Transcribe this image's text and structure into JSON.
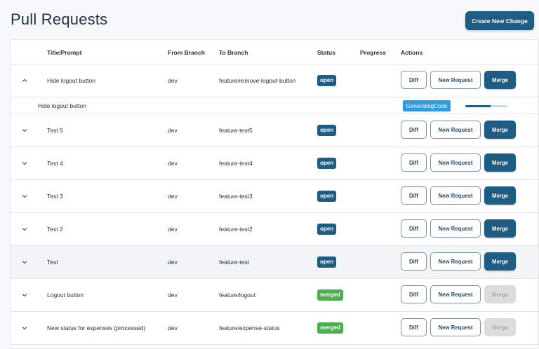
{
  "header": {
    "title": "Pull Requests",
    "create_button": "Create New Change"
  },
  "table": {
    "columns": {
      "title": "Title/Prompt",
      "from_branch": "From Branch",
      "to_branch": "To Branch",
      "status": "Status",
      "progress": "Progress",
      "actions": "Actions"
    },
    "action_labels": {
      "diff": "Diff",
      "new_request": "New Request",
      "merge": "Merge"
    },
    "expanded_detail": {
      "title": "Hide logout button",
      "state": "GeneratingCode",
      "progress": 0.6
    },
    "rows": [
      {
        "title": "Hide logout button",
        "from": "dev",
        "to": "feature/remove-logout-button",
        "status": "open",
        "expanded": true,
        "merge_enabled": true,
        "highlight": false
      },
      {
        "title": "Test 5",
        "from": "dev",
        "to": "feature-test5",
        "status": "open",
        "expanded": false,
        "merge_enabled": true,
        "highlight": false
      },
      {
        "title": "Test 4",
        "from": "dev",
        "to": "feature-test4",
        "status": "open",
        "expanded": false,
        "merge_enabled": true,
        "highlight": false
      },
      {
        "title": "Test 3",
        "from": "dev",
        "to": "feature-test3",
        "status": "open",
        "expanded": false,
        "merge_enabled": true,
        "highlight": false
      },
      {
        "title": "Test 2",
        "from": "dev",
        "to": "feature-test2",
        "status": "open",
        "expanded": false,
        "merge_enabled": true,
        "highlight": false
      },
      {
        "title": "Test",
        "from": "dev",
        "to": "feature-test",
        "status": "open",
        "expanded": false,
        "merge_enabled": true,
        "highlight": true
      },
      {
        "title": "Logout button",
        "from": "dev",
        "to": "feature/logout",
        "status": "merged",
        "expanded": false,
        "merge_enabled": false,
        "highlight": false
      },
      {
        "title": "New status for expenses (processed)",
        "from": "dev",
        "to": "feature/expense-status",
        "status": "merged",
        "expanded": false,
        "merge_enabled": false,
        "highlight": false
      }
    ]
  },
  "colors": {
    "primary": "#1f5c84",
    "status_open": "#1f5c84",
    "status_merged": "#4caf50",
    "generating": "#2f9be0",
    "disabled": "#dcdcdc"
  },
  "icons": {
    "expanded": "chevron-up-icon",
    "collapsed": "chevron-down-icon"
  }
}
